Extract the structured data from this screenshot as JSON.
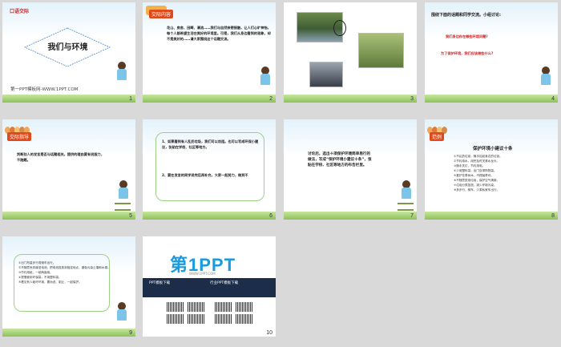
{
  "slides": [
    {
      "num": "1",
      "tag": "口语交际",
      "title": "我们与环境",
      "footer": "第一PPT模板网-WWW.1PPT.COM"
    },
    {
      "num": "2",
      "tag": "交际内容",
      "body": "花山、房舍、田畴、清流……我们与自然亲密接触，让人们心旷神怡。每个人都希望生活在美好的环境里。可是，我们从身边看到的现象，却不是美好的……请大家围绕这个话题交流。"
    },
    {
      "num": "3"
    },
    {
      "num": "4",
      "lead": "围绕下面的话题和同学交流。小组讨论:",
      "q1": "我们身边存在哪些环境问题?",
      "q2": "为了保护环境，我们应该做些什么?"
    },
    {
      "num": "5",
      "tag": "交际指导",
      "body": "判断别人的发言是否与话题相关。提供的理由要有说服力，不跑题。"
    },
    {
      "num": "6",
      "p1": "1、如果看到有人乱扔垃圾，我们可以劝阻。也可以写成环保小建议，张贴在学校、社区等地方。",
      "p2": "2、要在发言的同学说完后再补充，大家一起努力，做到不"
    },
    {
      "num": "7",
      "body": "讨论后，选出十项保护环境简单易行的做法，写成“保护环境小建议十条”，张贴在学校、社区等地方的布告栏里。"
    },
    {
      "num": "8",
      "tag": "范例",
      "title": "保护环境小建议十条",
      "items": [
        "①不乱扔垃圾，随手捡起身边的垃圾。",
        "②节约用水，用完及时关紧水龙头。",
        "③随手关灯，节约用电。",
        "④少用塑料袋，出门自带购物袋。",
        "⑤爱护花草树木，不践踏草坪。",
        "⑥不随意焚烧垃圾，保护空气清新。",
        "⑦垃圾分类投放，减少环境污染。",
        "⑧多步行、骑车，少乘私家车出行。"
      ]
    },
    {
      "num": "9",
      "items": [
        "①出门尽量步行或骑车出行。",
        "②不随意丢弃废旧电池，把电池投放到指定地点，避免污染土壤和水源。",
        "③节约用纸，一纸两面用。",
        "④提倡使用环保袋，不用塑料袋。",
        "⑤看见有人破坏环境，要劝说、制止，一起保护。"
      ]
    },
    {
      "num": "10",
      "logo": "第1PPT",
      "logo_sub": "WWW.1PPT.COM",
      "left_head": "PPT模板下载",
      "right_head": "行业PPT模板下载"
    }
  ]
}
